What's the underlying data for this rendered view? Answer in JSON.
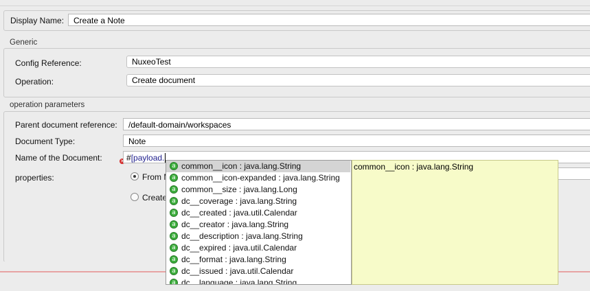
{
  "header": {
    "display_name_label": "Display Name:",
    "display_name_value": "Create a Note"
  },
  "generic": {
    "title": "Generic",
    "config_reference_label": "Config Reference:",
    "config_reference_value": "NuxeoTest",
    "operation_label": "Operation:",
    "operation_value": "Create document"
  },
  "operation_parameters": {
    "title": "operation parameters",
    "parent_label": "Parent document reference:",
    "parent_value": "/default-domain/workspaces",
    "doc_type_label": "Document Type:",
    "doc_type_value": "Note",
    "name_label": "Name of the Document:",
    "name_value_prefix": "#",
    "name_value_expr": "[payload.",
    "properties_label": "properties:",
    "radio_from": "From M",
    "radio_create": "Create"
  },
  "autocomplete": {
    "items": [
      {
        "text": "common__icon : java.lang.String",
        "badge": "a",
        "selected": true
      },
      {
        "text": "common__icon-expanded : java.lang.String",
        "badge": "a"
      },
      {
        "text": "common__size : java.lang.Long",
        "badge": "a"
      },
      {
        "text": "dc__coverage : java.lang.String",
        "badge": "a"
      },
      {
        "text": "dc__created : java.util.Calendar",
        "badge": "a"
      },
      {
        "text": "dc__creator : java.lang.String",
        "badge": "a"
      },
      {
        "text": "dc__description : java.lang.String",
        "badge": "a"
      },
      {
        "text": "dc__expired : java.util.Calendar",
        "badge": "a"
      },
      {
        "text": "dc__format : java.lang.String",
        "badge": "a"
      },
      {
        "text": "dc__issued : java.util.Calendar",
        "badge": "a"
      },
      {
        "text": "dc__language : java.lang.String",
        "badge": "a"
      }
    ],
    "doc_text": "common__icon : java.lang.String"
  },
  "colors": {
    "badge": "#3cae3c",
    "doc_background": "#f7fbc9",
    "selection": "#d4d4d4",
    "error": "#d42b2b",
    "expression": "#1e1e8c"
  }
}
